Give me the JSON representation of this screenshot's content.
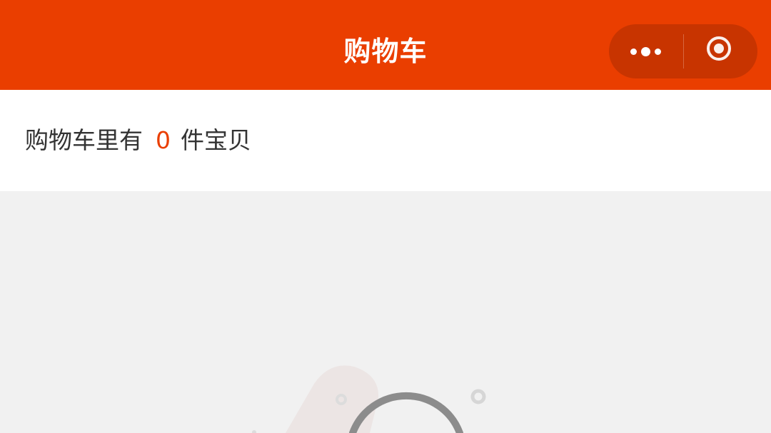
{
  "header": {
    "title": "购物车",
    "bg_color": "#ea3e00",
    "capsule": {
      "more_icon": "more-dots-icon",
      "close_icon": "target-circle-icon"
    }
  },
  "summary": {
    "prefix": "购物车里有",
    "count": "0",
    "suffix": "件宝贝",
    "count_color": "#ea3e00"
  },
  "empty_state": {
    "illustration_icon": "empty-cart-illustration"
  }
}
